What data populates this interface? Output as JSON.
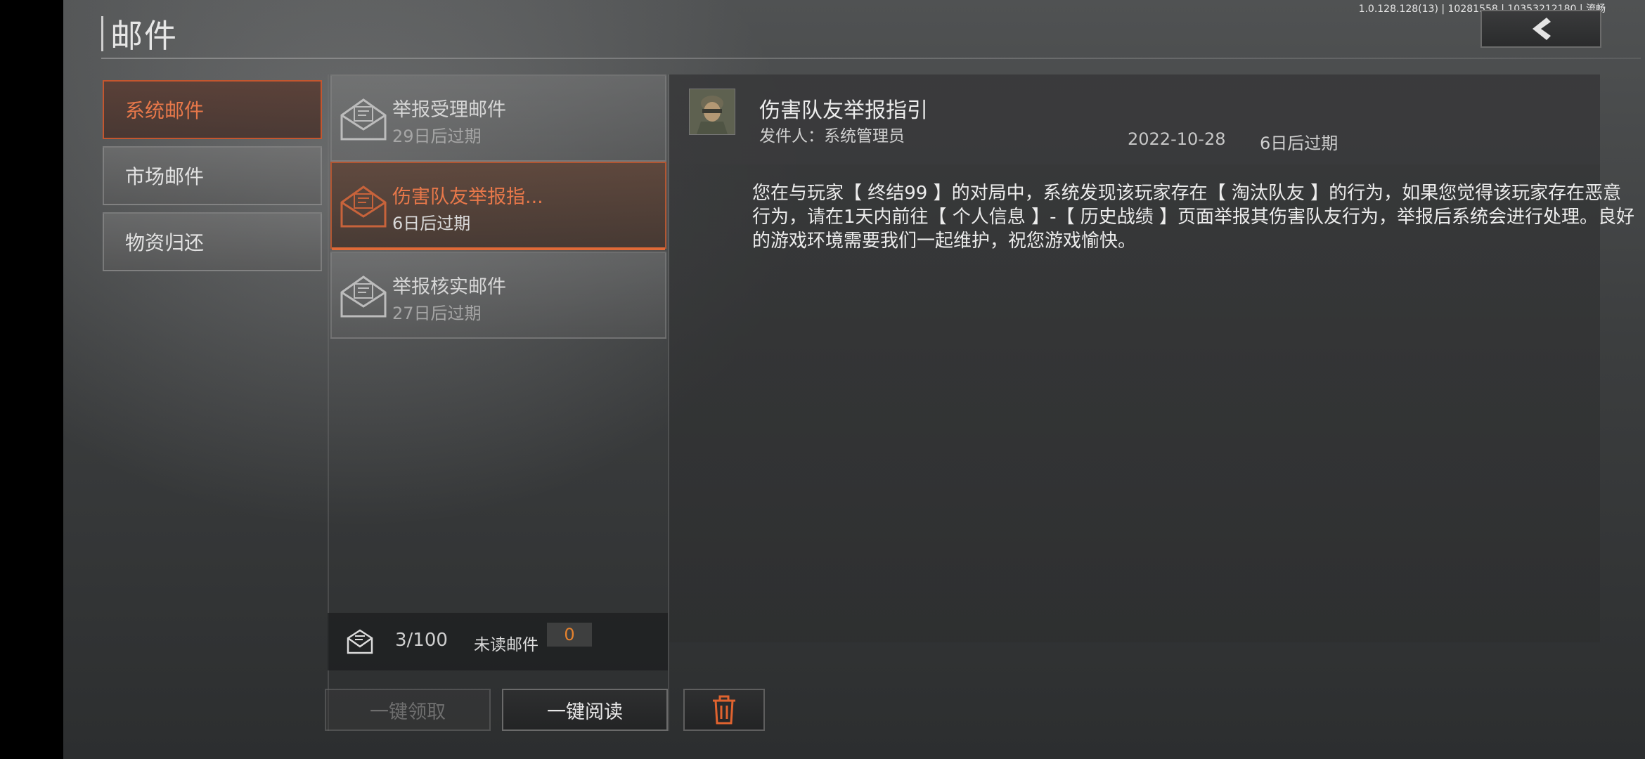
{
  "header": {
    "title": "邮件",
    "version": "1.0.128.128(13) | 10281558 | 10353212180 | 流畅"
  },
  "categories": [
    {
      "label": "系统邮件",
      "active": true
    },
    {
      "label": "市场邮件",
      "active": false
    },
    {
      "label": "物资归还",
      "active": false
    }
  ],
  "mails": [
    {
      "title": "举报受理邮件",
      "expiry": "29日后过期"
    },
    {
      "title": "伤害队友举报指...",
      "expiry": "6日后过期"
    },
    {
      "title": "举报核实邮件",
      "expiry": "27日后过期"
    }
  ],
  "stats": {
    "count": "3/100",
    "unread_label": "未读邮件",
    "unread_count": "0"
  },
  "buttons": {
    "claim_all": "一键领取",
    "read_all": "一键阅读",
    "delete_icon": "trash-icon"
  },
  "detail": {
    "title": "伤害队友举报指引",
    "sender": "发件人：系统管理员",
    "date": "2022-10-28",
    "expiry": "6日后过期",
    "body": "您在与玩家【 终结99 】的对局中，系统发现该玩家存在【 淘汰队友 】的行为，如果您觉得该玩家存在恶意行为，请在1天内前往【 个人信息 】-【 历史战绩 】页面举报其伤害队友行为，举报后系统会进行处理。良好的游戏环境需要我们一起维护，祝您游戏愉快。"
  },
  "colors": {
    "accent": "#e8784a",
    "unread": "#e5822e"
  }
}
